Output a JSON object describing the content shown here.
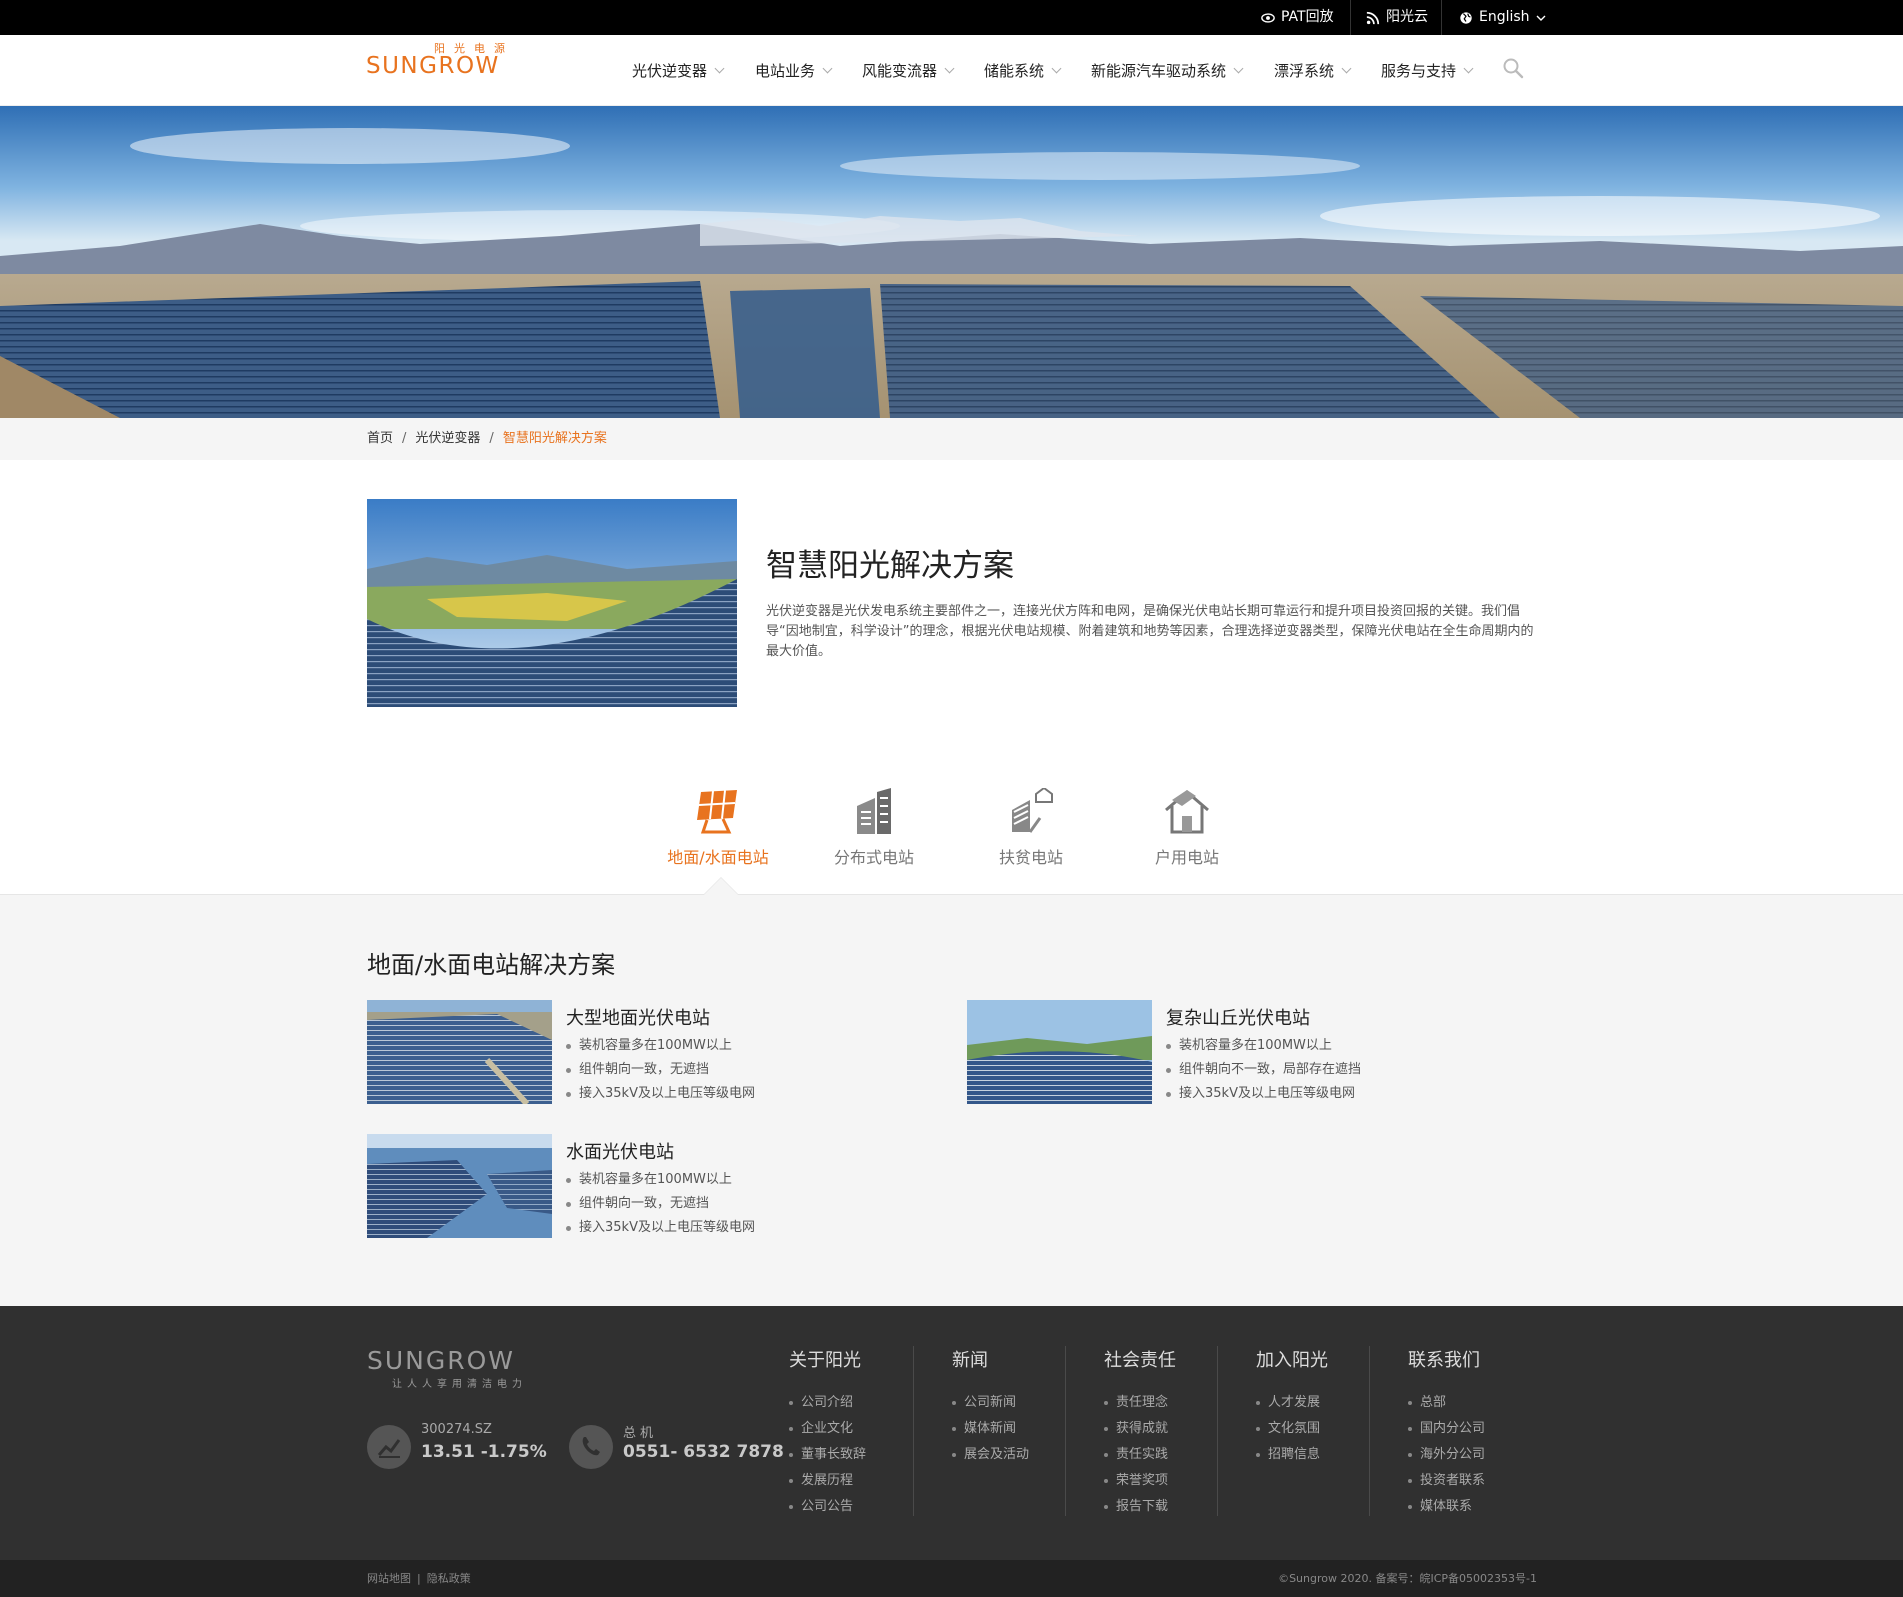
{
  "topbar": {
    "pat_label": "PAT回放",
    "cloud_label": "阳光云",
    "language_label": "English"
  },
  "brand": {
    "logo_cn": "阳光电源",
    "logo_en": "SUNGROW",
    "accent": "#e8731f"
  },
  "nav": {
    "items": [
      {
        "label": "光伏逆变器"
      },
      {
        "label": "电站业务"
      },
      {
        "label": "风能变流器"
      },
      {
        "label": "储能系统"
      },
      {
        "label": "新能源汽车驱动系统"
      },
      {
        "label": "漂浮系统"
      },
      {
        "label": "服务与支持"
      }
    ]
  },
  "breadcrumb": {
    "home": "首页",
    "separator": "/",
    "level1": "光伏逆变器",
    "current": "智慧阳光解决方案"
  },
  "intro": {
    "title": "智慧阳光解决方案",
    "text": "光伏逆变器是光伏发电系统主要部件之一，连接光伏方阵和电网，是确保光伏电站长期可靠运行和提升项目投资回报的关键。我们倡导“因地制宜，科学设计”的理念，根据光伏电站规模、附着建筑和地势等因素，合理选择逆变器类型，保障光伏电站在全生命周期内的最大价值。"
  },
  "tabs": [
    {
      "label": "地面/水面电站",
      "icon": "solar-panel-icon",
      "active": true
    },
    {
      "label": "分布式电站",
      "icon": "building-icon",
      "active": false
    },
    {
      "label": "扶贫电站",
      "icon": "rooftop-solar-icon",
      "active": false
    },
    {
      "label": "户用电站",
      "icon": "house-icon",
      "active": false
    }
  ],
  "solutions": {
    "title": "地面/水面电站解决方案",
    "cards": [
      {
        "title": "大型地面光伏电站",
        "bullets": [
          "装机容量多在100MW以上",
          "组件朝向一致，无遮挡",
          "接入35kV及以上电压等级电网"
        ]
      },
      {
        "title": "复杂山丘光伏电站",
        "bullets": [
          "装机容量多在100MW以上",
          "组件朝向不一致，局部存在遮挡",
          "接入35kV及以上电压等级电网"
        ]
      },
      {
        "title": "水面光伏电站",
        "bullets": [
          "装机容量多在100MW以上",
          "组件朝向一致，无遮挡",
          "接入35kV及以上电压等级电网"
        ]
      }
    ]
  },
  "footer": {
    "logo_en": "SUNGROW",
    "slogan": "让人人享用清洁电力",
    "stock_code": "300274.SZ",
    "stock_value": "13.51  -1.75%",
    "phone_label": "总机",
    "phone_value": "0551- 6532 7878",
    "columns": [
      {
        "title": "关于阳光",
        "items": [
          "公司介绍",
          "企业文化",
          "董事长致辞",
          "发展历程",
          "公司公告"
        ]
      },
      {
        "title": "新闻",
        "items": [
          "公司新闻",
          "媒体新闻",
          "展会及活动"
        ]
      },
      {
        "title": "社会责任",
        "items": [
          "责任理念",
          "获得成就",
          "责任实践",
          "荣誉奖项",
          "报告下载"
        ]
      },
      {
        "title": "加入阳光",
        "items": [
          "人才发展",
          "文化氛围",
          "招聘信息"
        ]
      },
      {
        "title": "联系我们",
        "items": [
          "总部",
          "国内分公司",
          "海外分公司",
          "投资者联系",
          "媒体联系"
        ]
      }
    ],
    "sitemap": "网站地图",
    "bar_sep": "|",
    "privacy": "隐私政策",
    "copyright": "©Sungrow 2020.  备案号：皖ICP备05002353号-1"
  }
}
